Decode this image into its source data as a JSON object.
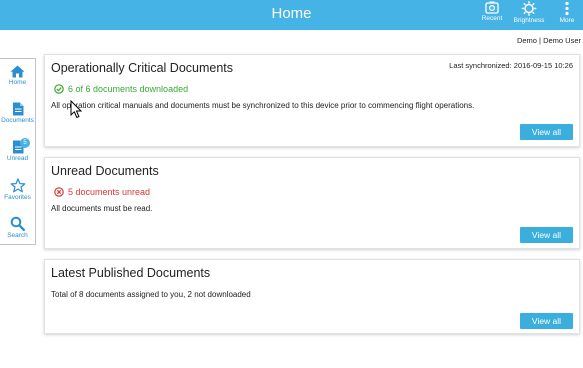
{
  "header": {
    "title": "Home",
    "actions": [
      {
        "label": "Recent",
        "icon": "camera-icon"
      },
      {
        "label": "Brightness",
        "icon": "brightness-icon"
      },
      {
        "label": "More",
        "icon": "more-icon"
      }
    ]
  },
  "user": "Demo | Demo User",
  "sidebar": {
    "items": [
      {
        "label": "Home",
        "icon": "home-icon"
      },
      {
        "label": "Documents",
        "icon": "documents-icon"
      },
      {
        "label": "Unread",
        "icon": "unread-icon",
        "badge": "5"
      },
      {
        "label": "Favorites",
        "icon": "star-icon"
      },
      {
        "label": "Search",
        "icon": "search-icon"
      }
    ]
  },
  "cards": {
    "critical": {
      "title": "Operationally Critical Documents",
      "sync": "Last synchronized: 2016-09-15 10:26",
      "status": "6 of 6 documents downloaded",
      "desc": "All operation critical manuals and documents must be synchronized to this device prior to commencing flight operations.",
      "button": "View all"
    },
    "unread": {
      "title": "Unread Documents",
      "status": "5 documents unread",
      "desc": "All documents must be read.",
      "button": "View all"
    },
    "latest": {
      "title": "Latest Published Documents",
      "desc": "Total of 8 documents assigned to you, 2 not downloaded",
      "button": "View all"
    }
  },
  "colors": {
    "header": "#45b3e6",
    "accent": "#2a8fd0",
    "ok": "#3aa934",
    "error": "#d9383a",
    "button": "#3aaedc"
  }
}
